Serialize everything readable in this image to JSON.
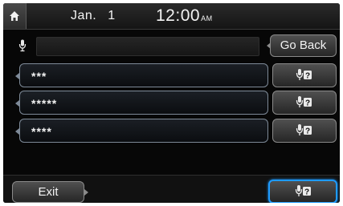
{
  "status_bar": {
    "month": "Jan.",
    "day": "1",
    "time": "12:00",
    "ampm": "AM"
  },
  "search": {
    "placeholder": "",
    "go_back_label": "Go Back"
  },
  "list_items": [
    {
      "label": "***"
    },
    {
      "label": "*****"
    },
    {
      "label": "****"
    }
  ],
  "bottom": {
    "exit_label": "Exit"
  },
  "icons": {
    "home": "home-icon",
    "mic": "microphone-icon",
    "voice_help": "voice-help-icon"
  },
  "colors": {
    "selection_accent": "#1e9bff"
  }
}
